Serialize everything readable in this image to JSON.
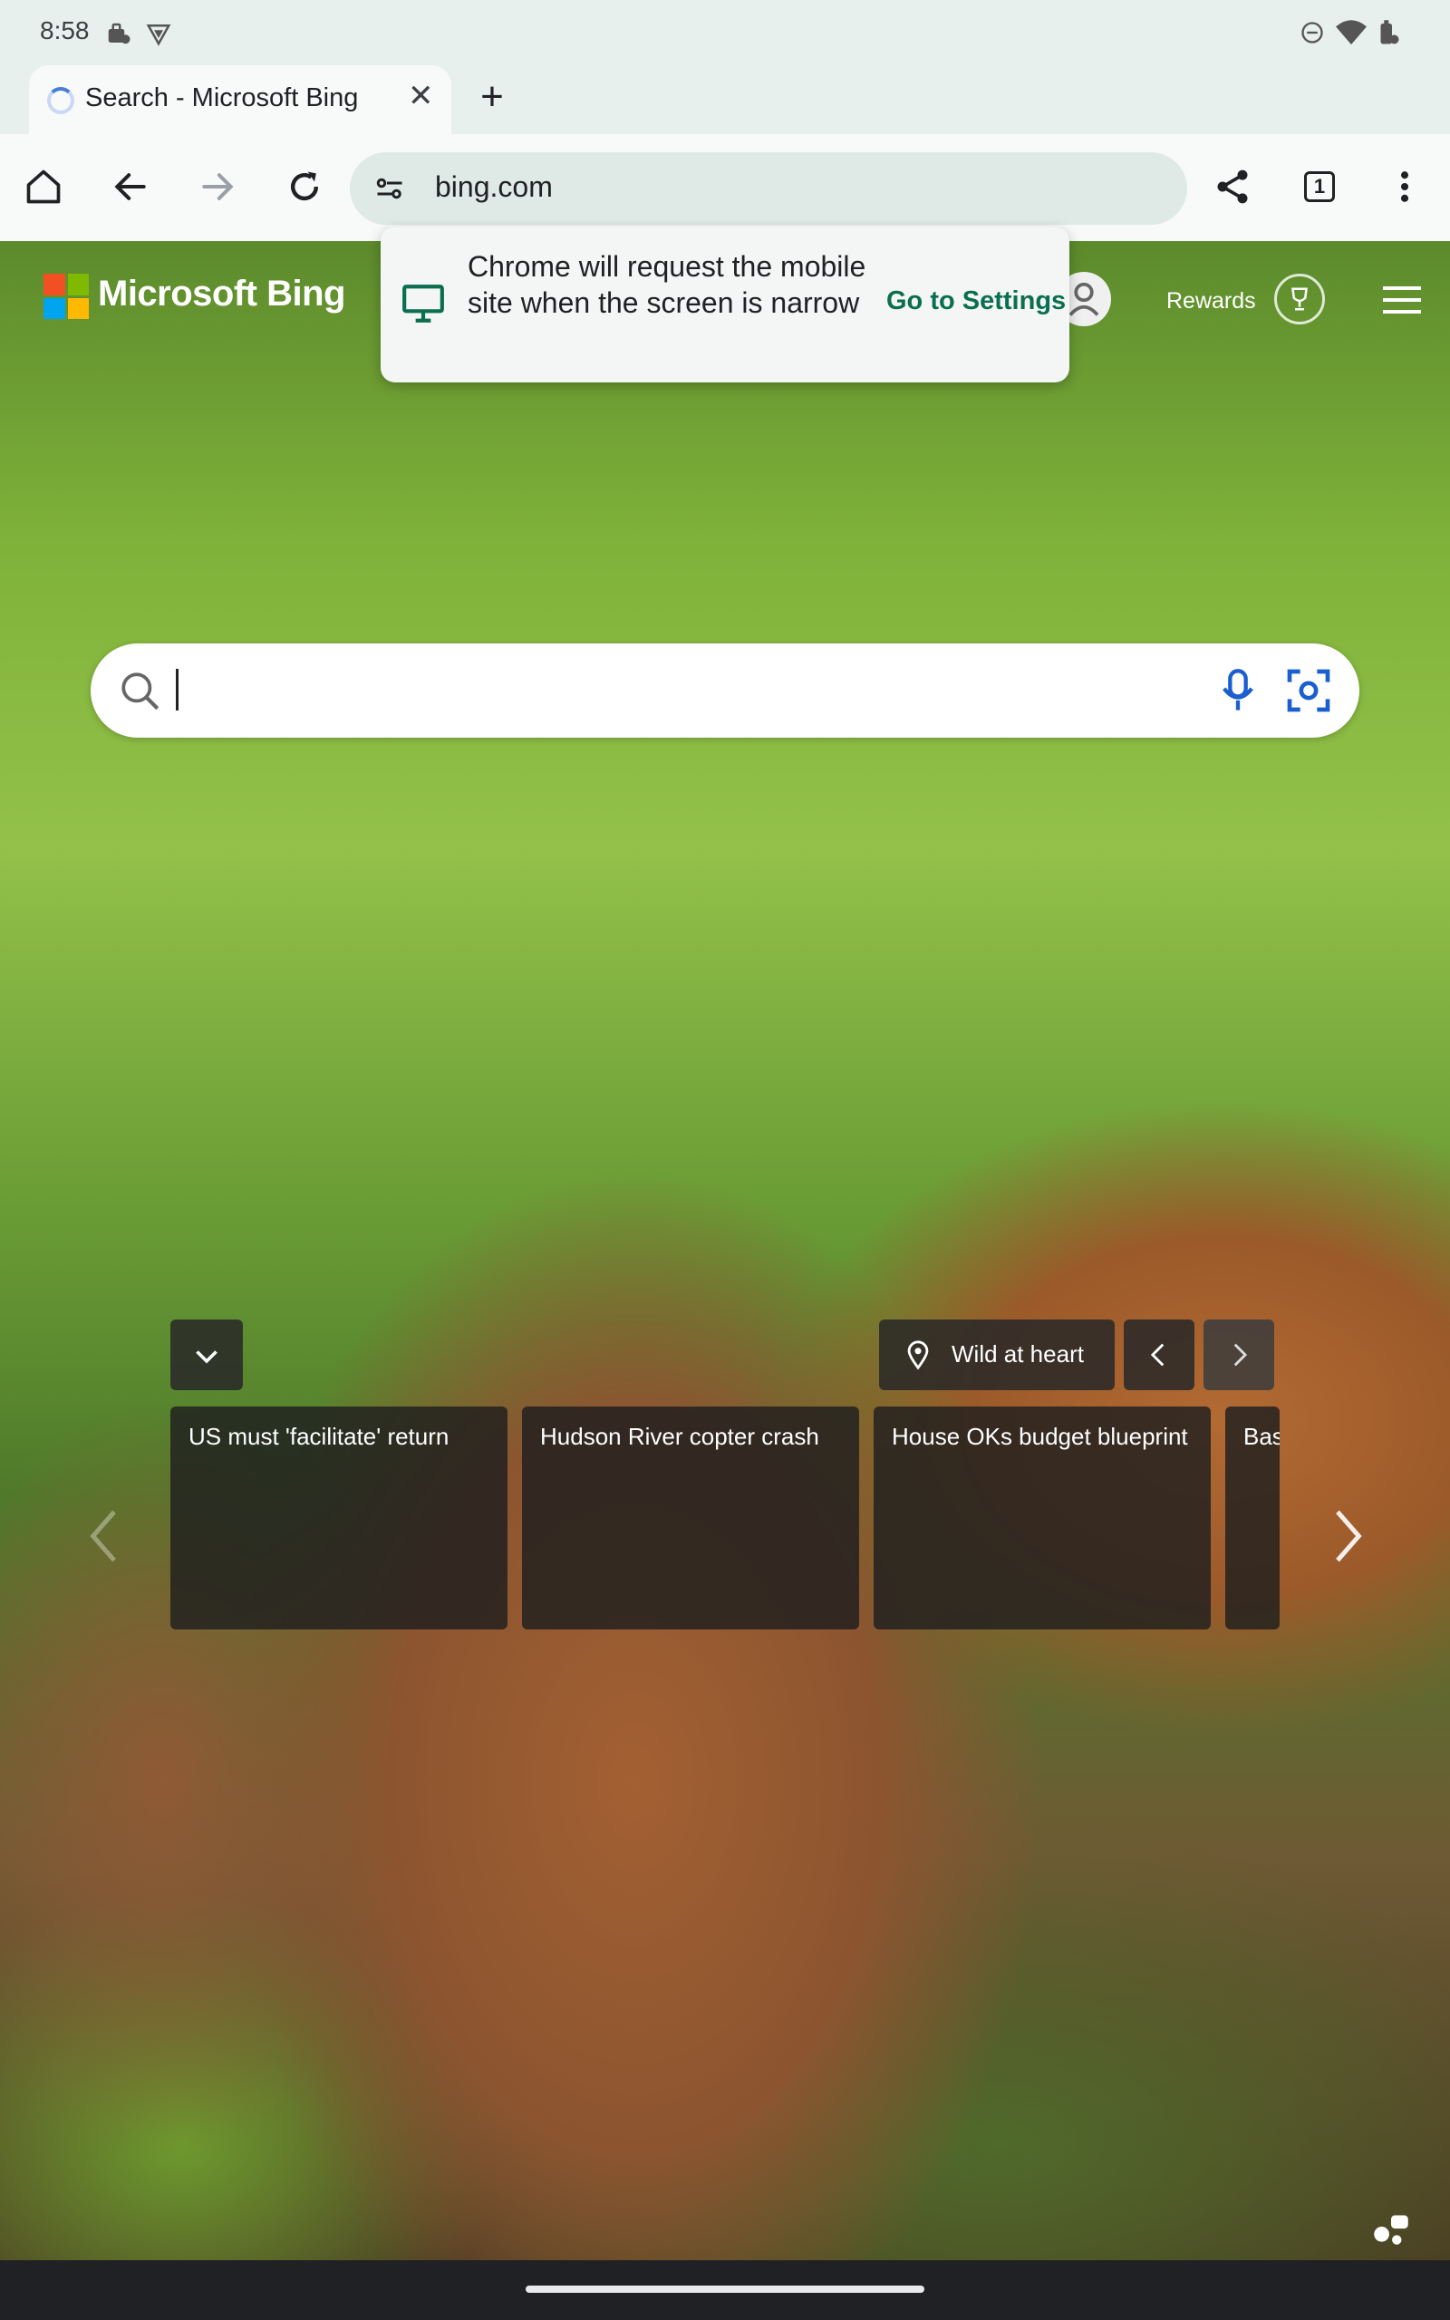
{
  "status_bar": {
    "time": "8:58"
  },
  "tab": {
    "title": "Search - Microsoft Bing"
  },
  "toolbar": {
    "url": "bing.com"
  },
  "tab_count": "1",
  "popup": {
    "message": "Chrome will request the mobile site when the screen is narrow",
    "link": "Go to Settings"
  },
  "bing": {
    "brand": "Microsoft Bing",
    "rewards_label": "Rewards",
    "logo_colors": [
      "#f25022",
      "#7fba00",
      "#00a4ef",
      "#ffb900"
    ]
  },
  "location": {
    "label": "Wild at heart"
  },
  "news": [
    {
      "title": "US must 'facilitate' return"
    },
    {
      "title": "Hudson River copter crash"
    },
    {
      "title": "House OKs budget blueprint"
    },
    {
      "title": "Bas"
    }
  ]
}
